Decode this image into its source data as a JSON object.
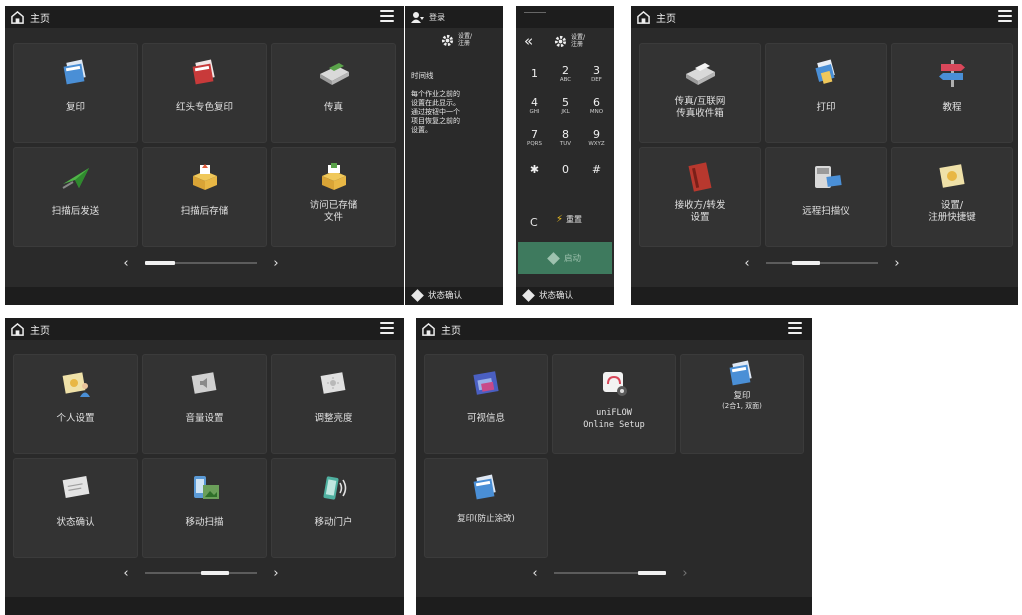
{
  "colors": {
    "screen_bg": "#2a2a2a",
    "bar_bg": "#1d1d1d",
    "tile_bg": "#333333",
    "start_bg": "#3e7a5e"
  },
  "screen1": {
    "title": "主页",
    "tiles": [
      {
        "label": "复印",
        "icon": "copy-icon"
      },
      {
        "label": "红头专色复印",
        "icon": "red-copy-icon"
      },
      {
        "label": "传真",
        "icon": "fax-icon"
      },
      {
        "label": "扫描后发送",
        "icon": "scan-send-icon"
      },
      {
        "label": "扫描后存储",
        "icon": "scan-store-icon"
      },
      {
        "label": "访问已存储文件",
        "label_l1": "访问已存储",
        "label_l2": "文件",
        "icon": "stored-files-icon"
      }
    ]
  },
  "side_panel": {
    "login_label": "登录",
    "settings_label_l1": "设置/",
    "settings_label_l2": "注册",
    "heading": "时间线",
    "body_lines": [
      "每个作业之前的",
      "设置在此显示。",
      "通过按钮中一个",
      "项目恢复之前的",
      "设置。"
    ],
    "status_label": "状态确认"
  },
  "keypad": {
    "back_label": "«",
    "settings_label_l1": "设置/",
    "settings_label_l2": "注册",
    "keys": [
      {
        "d": "1",
        "s": ""
      },
      {
        "d": "2",
        "s": "ABC"
      },
      {
        "d": "3",
        "s": "DEF"
      },
      {
        "d": "4",
        "s": "GHI"
      },
      {
        "d": "5",
        "s": "JKL"
      },
      {
        "d": "6",
        "s": "MNO"
      },
      {
        "d": "7",
        "s": "PQRS"
      },
      {
        "d": "8",
        "s": "TUV"
      },
      {
        "d": "9",
        "s": "WXYZ"
      },
      {
        "d": "✱",
        "s": ""
      },
      {
        "d": "0",
        "s": ""
      },
      {
        "d": "#",
        "s": ""
      }
    ],
    "clear_label": "C",
    "reset_label": "重置",
    "start_label": "启动",
    "status_label": "状态确认"
  },
  "screen2": {
    "title": "主页",
    "tiles": [
      {
        "label_l1": "传真/互联网",
        "label_l2": "传真收件箱",
        "icon": "fax-inbox-icon"
      },
      {
        "label": "打印",
        "icon": "print-icon"
      },
      {
        "label": "教程",
        "icon": "tutorial-signpost-icon"
      },
      {
        "label_l1": "接收方/转发",
        "label_l2": "设置",
        "icon": "address-book-icon"
      },
      {
        "label": "远程扫描仪",
        "icon": "remote-scanner-icon"
      },
      {
        "label_l1": "设置/",
        "label_l2": "注册快捷键",
        "icon": "shortcut-settings-icon"
      }
    ]
  },
  "screen3": {
    "title": "主页",
    "tiles": [
      {
        "label": "个人设置",
        "icon": "personal-settings-icon"
      },
      {
        "label": "音量设置",
        "icon": "volume-settings-icon"
      },
      {
        "label": "调整亮度",
        "icon": "brightness-icon"
      },
      {
        "label": "状态确认",
        "icon": "status-monitor-icon"
      },
      {
        "label": "移动扫描",
        "icon": "mobile-scan-icon"
      },
      {
        "label": "移动门户",
        "icon": "mobile-portal-icon"
      }
    ]
  },
  "screen4": {
    "title": "主页",
    "tiles": [
      {
        "label": "可视信息",
        "icon": "visual-message-icon"
      },
      {
        "label_l1": "uniFLOW",
        "label_l2": "Online Setup",
        "icon": "uniflow-setup-icon"
      },
      {
        "label_l1": "复印",
        "label_l2": "(2合1, 双面)",
        "icon": "copy-2in1-icon"
      },
      {
        "label": "复印(防止涂改)",
        "icon": "copy-tamper-icon"
      }
    ]
  }
}
